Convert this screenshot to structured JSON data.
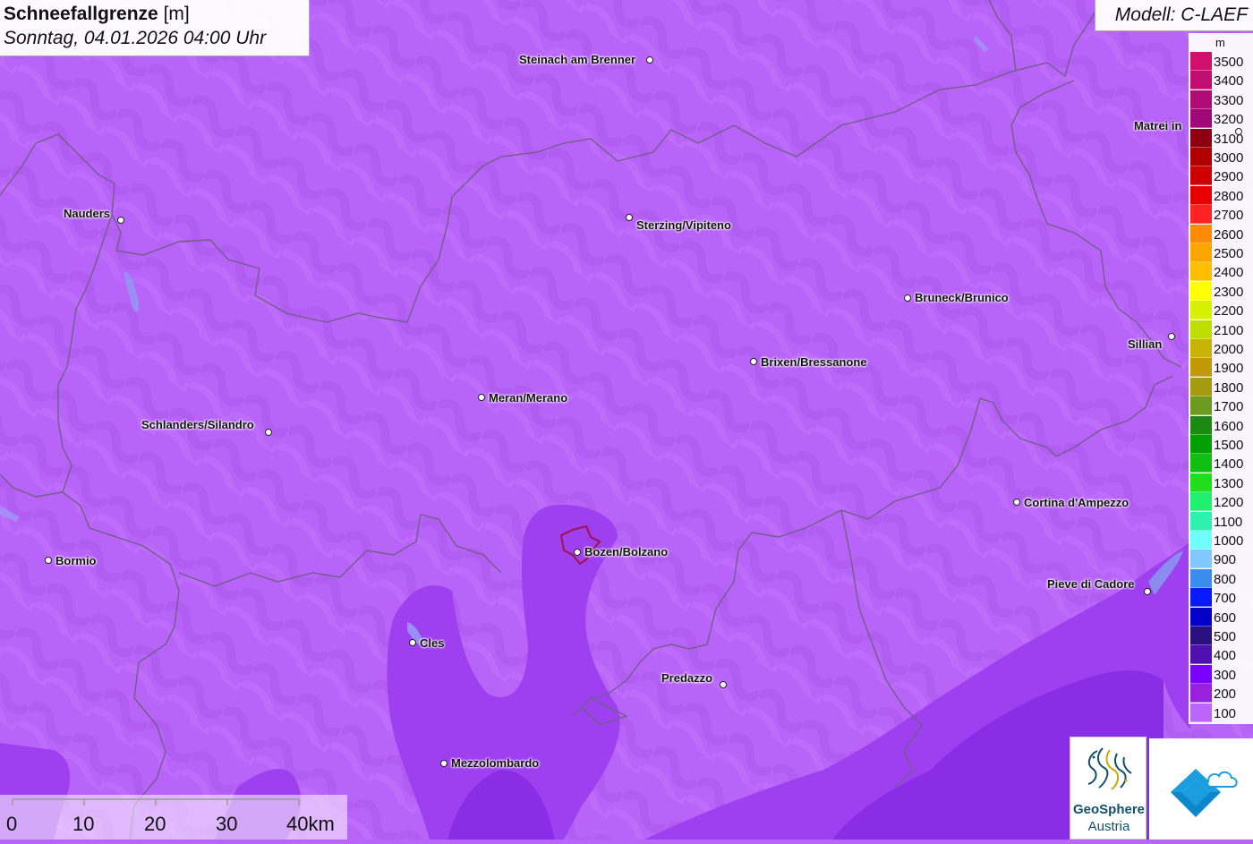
{
  "title": {
    "variable": "Schneefallgrenze",
    "unit": "[m]",
    "datetime": "Sonntag, 04.01.2026 04:00 Uhr"
  },
  "model": "Modell: C-LAEF",
  "legend": {
    "unit": "m",
    "levels": [
      {
        "value": "3500",
        "color": "#d0106a"
      },
      {
        "value": "3400",
        "color": "#c10c70"
      },
      {
        "value": "3300",
        "color": "#b00a74"
      },
      {
        "value": "3200",
        "color": "#a00878"
      },
      {
        "value": "3100",
        "color": "#8e0010"
      },
      {
        "value": "3000",
        "color": "#b00000"
      },
      {
        "value": "2900",
        "color": "#cc0000"
      },
      {
        "value": "2800",
        "color": "#e60000"
      },
      {
        "value": "2700",
        "color": "#ff2222"
      },
      {
        "value": "2600",
        "color": "#ff8c00"
      },
      {
        "value": "2500",
        "color": "#ffa500"
      },
      {
        "value": "2400",
        "color": "#ffbe00"
      },
      {
        "value": "2300",
        "color": "#ffff00"
      },
      {
        "value": "2200",
        "color": "#d6f000"
      },
      {
        "value": "2100",
        "color": "#bede00"
      },
      {
        "value": "2000",
        "color": "#c8b400"
      },
      {
        "value": "1900",
        "color": "#c09a00"
      },
      {
        "value": "1800",
        "color": "#a59a10"
      },
      {
        "value": "1700",
        "color": "#6a9a20"
      },
      {
        "value": "1600",
        "color": "#1a8a10"
      },
      {
        "value": "1500",
        "color": "#00a000"
      },
      {
        "value": "1400",
        "color": "#10c010"
      },
      {
        "value": "1300",
        "color": "#20dd20"
      },
      {
        "value": "1200",
        "color": "#20f070"
      },
      {
        "value": "1100",
        "color": "#30f0b0"
      },
      {
        "value": "1000",
        "color": "#70ffff"
      },
      {
        "value": "900",
        "color": "#80c8ff"
      },
      {
        "value": "800",
        "color": "#3c8cf0"
      },
      {
        "value": "700",
        "color": "#0a1aff"
      },
      {
        "value": "600",
        "color": "#0000c8"
      },
      {
        "value": "500",
        "color": "#2a1080"
      },
      {
        "value": "400",
        "color": "#5010b0"
      },
      {
        "value": "300",
        "color": "#7a00ff"
      },
      {
        "value": "200",
        "color": "#9a20e0"
      },
      {
        "value": "100",
        "color": "#bb66ff"
      }
    ]
  },
  "cities": [
    {
      "name": "Steinach am Brenner",
      "side": "left"
    },
    {
      "name": "Nauders",
      "side": "left"
    },
    {
      "name": "Sterzing/Vipiteno",
      "side": "right"
    },
    {
      "name": "Matrei in",
      "side": "left"
    },
    {
      "name": "Bruneck/Brunico",
      "side": "right"
    },
    {
      "name": "Sillian",
      "side": "left"
    },
    {
      "name": "Brixen/Bressanone",
      "side": "right"
    },
    {
      "name": "Meran/Merano",
      "side": "right"
    },
    {
      "name": "Schlanders/Silandro",
      "side": "left"
    },
    {
      "name": "Cortina d'Ampezzo",
      "side": "right"
    },
    {
      "name": "Bormio",
      "side": "right"
    },
    {
      "name": "Bozen/Bolzano",
      "side": "right"
    },
    {
      "name": "Pieve di Cadore",
      "side": "left"
    },
    {
      "name": "Cles",
      "side": "right"
    },
    {
      "name": "Predazzo",
      "side": "left"
    },
    {
      "name": "Mezzolombardo",
      "side": "right"
    }
  ],
  "scale": {
    "labels": [
      "0",
      "10",
      "20",
      "30",
      "40km"
    ]
  },
  "logos": {
    "geosphere_line1": "GeoSphere",
    "geosphere_line2": "Austria"
  },
  "colors": {
    "base": "#b964f9",
    "zone_200": "#9d3cf0",
    "zone_300": "#8525e6",
    "border": "#6f5f88"
  }
}
